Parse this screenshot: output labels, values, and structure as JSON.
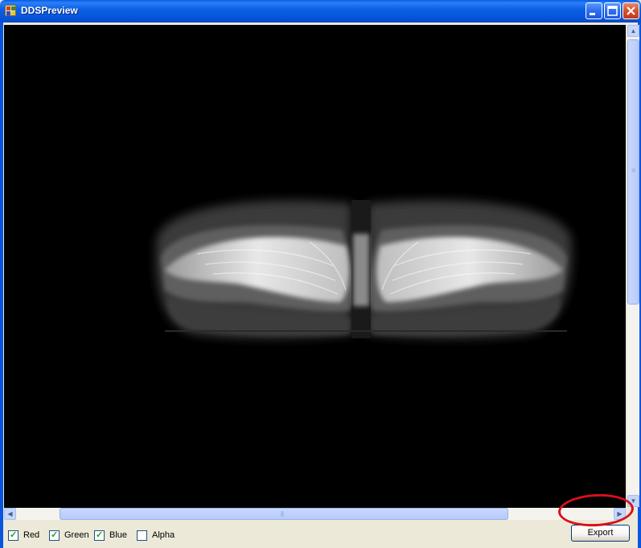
{
  "window": {
    "title": "DDSPreview"
  },
  "channels": [
    {
      "label": "Red",
      "checked": true
    },
    {
      "label": "Green",
      "checked": true
    },
    {
      "label": "Blue",
      "checked": true
    },
    {
      "label": "Alpha",
      "checked": false
    }
  ],
  "actions": {
    "export_label": "Export"
  },
  "colors": {
    "titlebar": "#0a5be6",
    "annotation": "#d90f1a",
    "preview_bg": "#000000"
  },
  "icons": [
    "app-icon",
    "minimize-icon",
    "maximize-icon",
    "close-icon",
    "scroll-up-icon",
    "scroll-down-icon",
    "scroll-left-icon",
    "scroll-right-icon",
    "checkmark-icon"
  ]
}
